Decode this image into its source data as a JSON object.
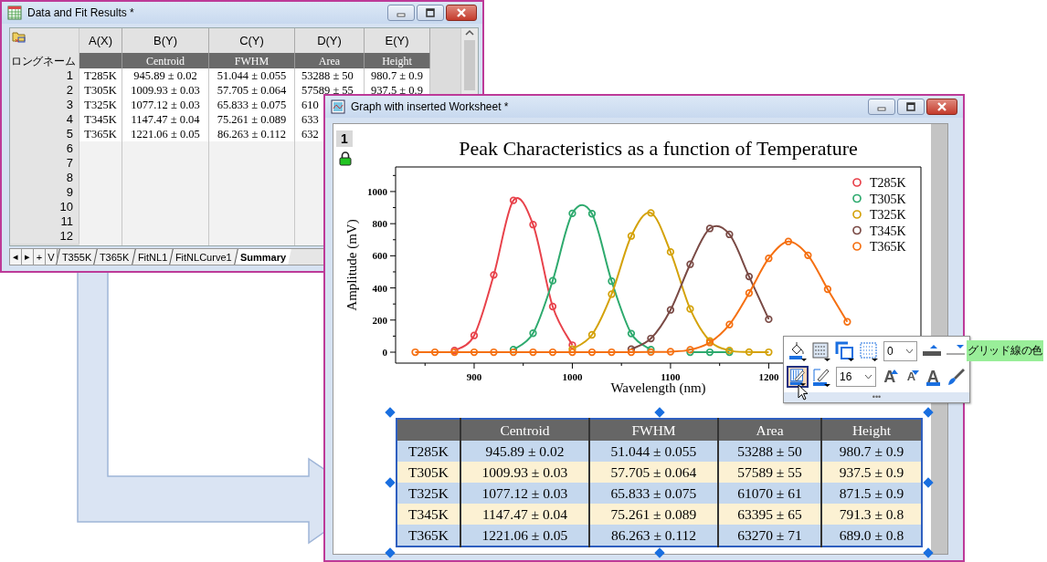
{
  "worksheet_window": {
    "title": "Data and Fit Results *",
    "columns": [
      {
        "name": "A(X)"
      },
      {
        "name": "B(Y)",
        "long_name": "Centroid"
      },
      {
        "name": "C(Y)",
        "long_name": "FWHM"
      },
      {
        "name": "D(Y)",
        "long_name": "Area"
      },
      {
        "name": "E(Y)",
        "long_name": "Height"
      }
    ],
    "long_name_label": "ロングネーム",
    "row_numbers": [
      "1",
      "2",
      "3",
      "4",
      "5",
      "6",
      "7",
      "8",
      "9",
      "10",
      "11",
      "12"
    ],
    "rows": [
      [
        "T285K",
        "945.89 ± 0.02",
        "51.044 ± 0.055",
        "53288 ± 50",
        "980.7 ± 0.9"
      ],
      [
        "T305K",
        "1009.93 ± 0.03",
        "57.705 ± 0.064",
        "57589 ± 55",
        "937.5 ± 0.9"
      ],
      [
        "T325K",
        "1077.12 ± 0.03",
        "65.833 ± 0.075",
        "610"
      ],
      [
        "T345K",
        "1147.47 ± 0.04",
        "75.261 ± 0.089",
        "633"
      ],
      [
        "T365K",
        "1221.06 ± 0.05",
        "86.263 ± 0.112",
        "632"
      ]
    ],
    "nav_buttons": [
      "◂",
      "▸",
      "+",
      "V"
    ],
    "sheet_tabs": [
      {
        "label": "T355K",
        "selected": false
      },
      {
        "label": "T365K",
        "selected": false
      },
      {
        "label": "FitNL1",
        "selected": false
      },
      {
        "label": "FitNLCurve1",
        "selected": false
      },
      {
        "label": "Summary",
        "selected": true
      }
    ]
  },
  "graph_window": {
    "title": "Graph with inserted Worksheet *",
    "layer": "1",
    "chart_data": {
      "type": "line",
      "title": "Peak Characteristics as a function of Temperature",
      "xlabel": "Wavelength (nm)",
      "ylabel": "Amplitude (mV)",
      "xlim": [
        820,
        1355
      ],
      "ylim": [
        -68,
        1153
      ],
      "xticks": [
        900,
        1000,
        1100,
        1200
      ],
      "yticks": [
        0,
        200,
        400,
        600,
        800,
        1000
      ],
      "x": [
        840,
        860,
        880,
        900,
        920,
        940,
        960,
        980,
        1000,
        1020,
        1040,
        1060,
        1080,
        1100,
        1120,
        1140,
        1160,
        1180,
        1200,
        1220,
        1240,
        1260,
        1280
      ],
      "legend": "upper right",
      "series": [
        {
          "name": "T285K",
          "color": "#e8424b",
          "marker": "circle",
          "values": [
            null,
            null,
            10,
            104,
            481,
            945,
            794,
            284,
            44,
            null,
            null,
            null,
            null,
            null,
            null,
            null,
            null,
            null,
            null,
            null,
            null,
            null,
            null
          ]
        },
        {
          "name": "T305K",
          "color": "#2eaa6e",
          "marker": "circle",
          "values": [
            null,
            null,
            null,
            null,
            null,
            16,
            118,
            445,
            864,
            862,
            442,
            116,
            16,
            null,
            0,
            0,
            0,
            null,
            null,
            null,
            null,
            null,
            null
          ]
        },
        {
          "name": "T325K",
          "color": "#d4a20a",
          "marker": "circle",
          "values": [
            null,
            null,
            null,
            null,
            null,
            null,
            null,
            null,
            19,
            108,
            361,
            723,
            867,
            624,
            269,
            70,
            11,
            1,
            0,
            null,
            null,
            null,
            null
          ]
        },
        {
          "name": "T345K",
          "color": "#7a4a45",
          "marker": "circle",
          "values": [
            null,
            null,
            null,
            null,
            null,
            null,
            null,
            null,
            null,
            null,
            null,
            19,
            85,
            263,
            547,
            770,
            733,
            471,
            205,
            null,
            null,
            null,
            null
          ]
        },
        {
          "name": "T365K",
          "color": "#f57012",
          "marker": "circle",
          "values": [
            0,
            0,
            0,
            0,
            0,
            0,
            0,
            0,
            0,
            0,
            0,
            0,
            1,
            3,
            15,
            60,
            172,
            368,
            584,
            689,
            603,
            392,
            189
          ]
        }
      ]
    },
    "table": {
      "columns": [
        "",
        "Centroid",
        "FWHM",
        "Area",
        "Height"
      ],
      "rows": [
        [
          "T285K",
          "945.89 ± 0.02",
          "51.044 ± 0.055",
          "53288 ± 50",
          "980.7 ± 0.9"
        ],
        [
          "T305K",
          "1009.93 ± 0.03",
          "57.705 ± 0.064",
          "57589 ± 55",
          "937.5 ± 0.9"
        ],
        [
          "T325K",
          "1077.12 ± 0.03",
          "65.833 ± 0.075",
          "61070 ± 61",
          "871.5 ± 0.9"
        ],
        [
          "T345K",
          "1147.47 ± 0.04",
          "75.261 ± 0.089",
          "63395 ± 65",
          "791.3 ± 0.8"
        ],
        [
          "T365K",
          "1221.06 ± 0.05",
          "86.263 ± 0.112",
          "63270 ± 71",
          "689.0 ± 0.8"
        ]
      ]
    }
  },
  "mini_toolbar": {
    "top_row": [
      {
        "kind": "fill",
        "selected": false
      },
      {
        "kind": "grid",
        "selected": false
      },
      {
        "kind": "layer",
        "selected": false
      },
      {
        "kind": "pattern",
        "selected": false
      },
      {
        "kind": "dropdown",
        "value": "0",
        "selected": false
      },
      {
        "kind": "thick",
        "selected": false
      },
      {
        "kind": "thin",
        "selected": false
      }
    ],
    "bottom_row": [
      {
        "kind": "grid_color",
        "selected": true
      },
      {
        "kind": "pen",
        "selected": false
      },
      {
        "kind": "dropdown",
        "value": "16",
        "selected": false
      },
      {
        "kind": "font_up",
        "glyph": "A",
        "selected": false
      },
      {
        "kind": "font_down",
        "glyph": "A",
        "selected": false
      },
      {
        "kind": "font_color",
        "glyph": "A",
        "selected": false
      },
      {
        "kind": "brush",
        "selected": false
      }
    ],
    "more": "•••",
    "tooltip": "グリッド線の色"
  }
}
